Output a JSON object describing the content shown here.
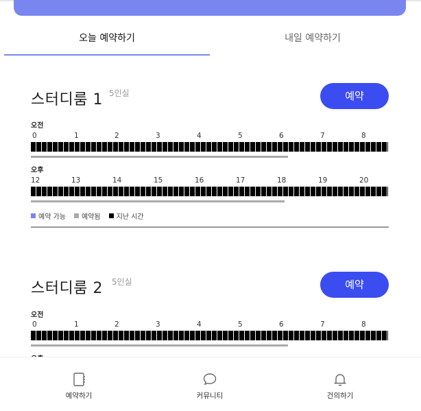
{
  "tabs": {
    "today": "오늘 예약하기",
    "tomorrow": "내일 예약하기"
  },
  "rooms": [
    {
      "name": "스터디룸 1",
      "capacity": "5인실",
      "reserve_label": "예약",
      "am_label": "오전",
      "am_hours": [
        "0",
        "1",
        "2",
        "3",
        "4",
        "5",
        "6",
        "7",
        "8"
      ],
      "am_progress": 0.72,
      "pm_label": "오후",
      "pm_hours": [
        "12",
        "13",
        "14",
        "15",
        "16",
        "17",
        "18",
        "19",
        "20"
      ],
      "pm_progress": 0.71
    },
    {
      "name": "스터디룸 2",
      "capacity": "5인실",
      "reserve_label": "예약",
      "am_label": "오전",
      "am_hours": [
        "0",
        "1",
        "2",
        "3",
        "4",
        "5",
        "6",
        "7",
        "8"
      ],
      "am_progress": 0.72,
      "pm_label": "오후"
    }
  ],
  "legend": {
    "available": "예약 가능",
    "reserved": "예약됨",
    "past": "지난 시간"
  },
  "colors": {
    "accent": "#3b4cf0",
    "available": "#7a86f0",
    "reserved": "#a9a9a9",
    "past": "#000000"
  },
  "nav": [
    {
      "label": "예약하기",
      "icon": "notebook-icon"
    },
    {
      "label": "커뮤니티",
      "icon": "chat-bubble-icon"
    },
    {
      "label": "건의하기",
      "icon": "bell-icon"
    }
  ]
}
